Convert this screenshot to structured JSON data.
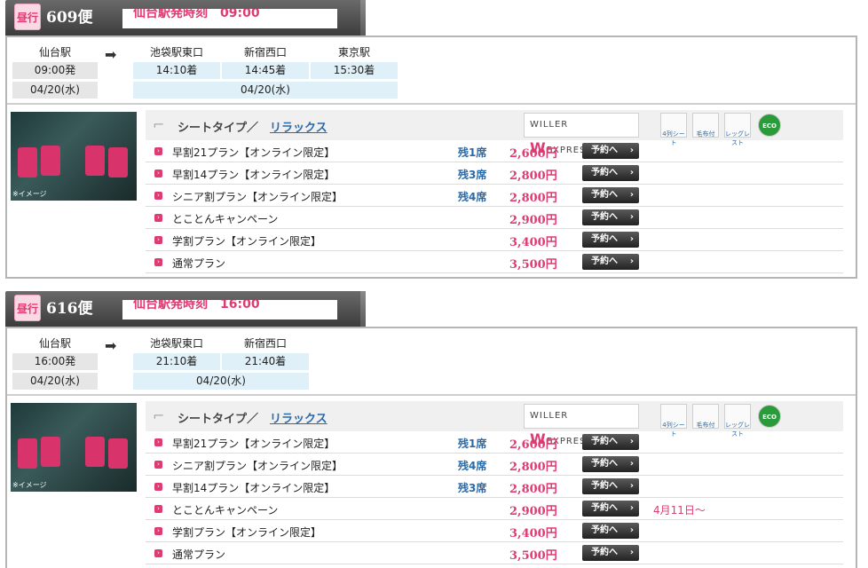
{
  "blocks": [
    {
      "badge": "昼行",
      "flight": "609便",
      "depart_label": "仙台駅発時刻　09:00",
      "origin": {
        "name": "仙台駅",
        "time": "09:00発",
        "date": "04/20(水)"
      },
      "arrow": "➡",
      "stops": [
        {
          "name": "池袋駅東口",
          "time": "14:10着"
        },
        {
          "name": "新宿西口",
          "time": "14:45着"
        },
        {
          "name": "東京駅",
          "time": "15:30着"
        }
      ],
      "dest_date": "04/20(水)",
      "seat_type_label": "シートタイプ／",
      "seat_type_link": "リラックス",
      "brand": {
        "pre": "WILLER ",
        "w": "W",
        "post": "EXPRESS."
      },
      "features": [
        "4列シート",
        "毛布付",
        "レッグレスト",
        "ECO"
      ],
      "photo_label": "※イメージ",
      "plans": [
        {
          "name": "早割21プラン【オンライン限定】",
          "left": "残1席",
          "price": "2,600円",
          "button": "予約へ",
          "note": ""
        },
        {
          "name": "早割14プラン【オンライン限定】",
          "left": "残3席",
          "price": "2,800円",
          "button": "予約へ",
          "note": ""
        },
        {
          "name": "シニア割プラン【オンライン限定】",
          "left": "残4席",
          "price": "2,800円",
          "button": "予約へ",
          "note": ""
        },
        {
          "name": "とことんキャンペーン",
          "left": "",
          "price": "2,900円",
          "button": "予約へ",
          "note": ""
        },
        {
          "name": "学割プラン【オンライン限定】",
          "left": "",
          "price": "3,400円",
          "button": "予約へ",
          "note": ""
        },
        {
          "name": "通常プラン",
          "left": "",
          "price": "3,500円",
          "button": "予約へ",
          "note": ""
        }
      ]
    },
    {
      "badge": "昼行",
      "flight": "616便",
      "depart_label": "仙台駅発時刻　16:00",
      "origin": {
        "name": "仙台駅",
        "time": "16:00発",
        "date": "04/20(水)"
      },
      "arrow": "➡",
      "stops": [
        {
          "name": "池袋駅東口",
          "time": "21:10着"
        },
        {
          "name": "新宿西口",
          "time": "21:40着"
        }
      ],
      "dest_date": "04/20(水)",
      "seat_type_label": "シートタイプ／",
      "seat_type_link": "リラックス",
      "brand": {
        "pre": "WILLER ",
        "w": "W",
        "post": "EXPRESS."
      },
      "features": [
        "4列シート",
        "毛布付",
        "レッグレスト",
        "ECO"
      ],
      "photo_label": "※イメージ",
      "plans": [
        {
          "name": "早割21プラン【オンライン限定】",
          "left": "残1席",
          "price": "2,600円",
          "button": "予約へ",
          "note": ""
        },
        {
          "name": "シニア割プラン【オンライン限定】",
          "left": "残4席",
          "price": "2,800円",
          "button": "予約へ",
          "note": ""
        },
        {
          "name": "早割14プラン【オンライン限定】",
          "left": "残3席",
          "price": "2,800円",
          "button": "予約へ",
          "note": ""
        },
        {
          "name": "とことんキャンペーン",
          "left": "",
          "price": "2,900円",
          "button": "予約へ",
          "note": "4月11日～"
        },
        {
          "name": "学割プラン【オンライン限定】",
          "left": "",
          "price": "3,400円",
          "button": "予約へ",
          "note": ""
        },
        {
          "name": "通常プラン",
          "left": "",
          "price": "3,500円",
          "button": "予約へ",
          "note": ""
        }
      ]
    }
  ]
}
